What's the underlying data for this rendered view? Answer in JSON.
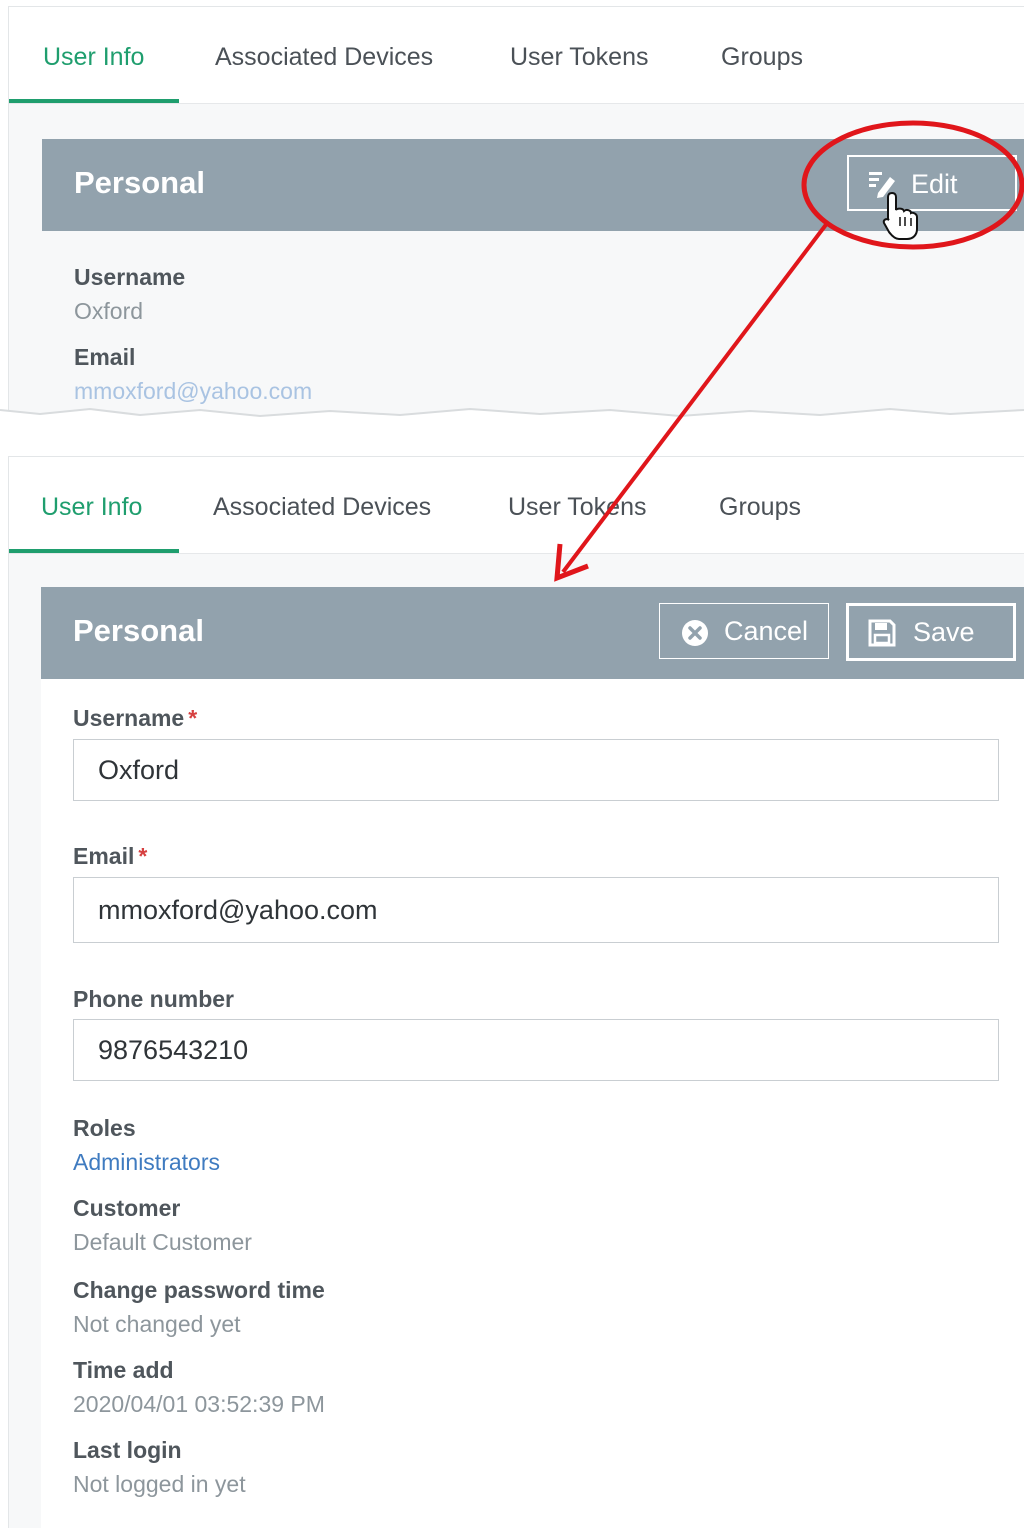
{
  "tabs": [
    {
      "label": "User Info",
      "active": true
    },
    {
      "label": "Associated Devices",
      "active": false
    },
    {
      "label": "User Tokens",
      "active": false
    },
    {
      "label": "Groups",
      "active": false
    }
  ],
  "view_panel": {
    "title": "Personal",
    "edit_label": "Edit",
    "fields": {
      "username_label": "Username",
      "username_value": "Oxford",
      "email_label": "Email",
      "email_value": "mmoxford@yahoo.com"
    }
  },
  "edit_panel": {
    "title": "Personal",
    "cancel_label": "Cancel",
    "save_label": "Save",
    "required_mark": "*",
    "username_label": "Username",
    "username_value": "Oxford",
    "email_label": "Email",
    "email_value": "mmoxford@yahoo.com",
    "phone_label": "Phone number",
    "phone_value": "9876543210",
    "roles_label": "Roles",
    "roles_value": "Administrators",
    "customer_label": "Customer",
    "customer_value": "Default Customer",
    "change_password_label": "Change password time",
    "change_password_value": "Not changed yet",
    "time_add_label": "Time add",
    "time_add_value": "2020/04/01 03:52:39 PM",
    "last_login_label": "Last login",
    "last_login_value": "Not logged in yet"
  },
  "colors": {
    "accent": "#1f9e6e",
    "header": "#92a2ad",
    "annotation": "#e0161b",
    "link": "#3f7bc0"
  },
  "icons": {
    "edit": "pencil-edit-icon",
    "cancel": "circle-x-icon",
    "save": "floppy-disk-icon",
    "cursor": "hand-pointer-icon"
  }
}
